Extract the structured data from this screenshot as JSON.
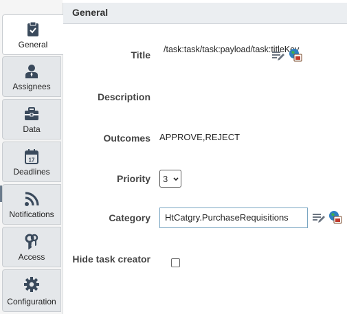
{
  "tabs": [
    {
      "label": "General",
      "icon": "clipboard-check-icon",
      "active": true
    },
    {
      "label": "Assignees",
      "icon": "user-icon"
    },
    {
      "label": "Data",
      "icon": "briefcase-icon"
    },
    {
      "label": "Deadlines",
      "icon": "calendar-icon"
    },
    {
      "label": "Notifications",
      "icon": "rss-icon"
    },
    {
      "label": "Access",
      "icon": "keys-icon"
    },
    {
      "label": "Configuration",
      "icon": "gear-icon"
    }
  ],
  "calendar_day": "17",
  "panel": {
    "title": "General"
  },
  "form": {
    "title": {
      "label": "Title",
      "value": "/task:task/task:payload/task:titleKey"
    },
    "description": {
      "label": "Description",
      "value": ""
    },
    "outcomes": {
      "label": "Outcomes",
      "value": "APPROVE,REJECT"
    },
    "priority": {
      "label": "Priority",
      "value": "3"
    },
    "category": {
      "label": "Category",
      "value": "HtCatgry.PurchaseRequisitions"
    },
    "hide_creator": {
      "label": "Hide task creator",
      "checked": false
    }
  },
  "icons": {
    "edit": "edit-expression-icon",
    "browse": "browse-globe-icon"
  },
  "colors": {
    "accent": "#3a4a5c",
    "tab_bg": "#e4e7ea",
    "header_bg": "#ebeef1"
  }
}
